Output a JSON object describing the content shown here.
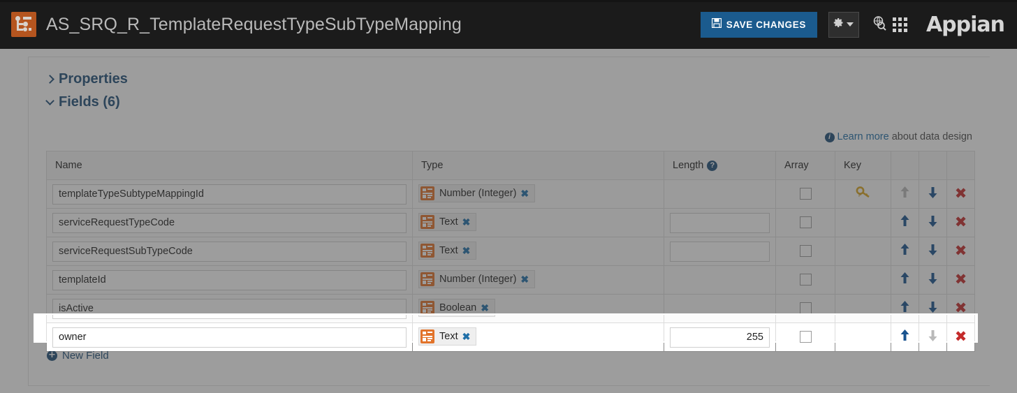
{
  "header": {
    "app_icon_name": "object-icon",
    "title": "AS_SRQ_R_TemplateRequestTypeSubTypeMapping",
    "save_label": "SAVE CHANGES",
    "settings_icon": "gear-icon",
    "caret_icon": "chevron-down-icon",
    "search_icon": "search-globe-icon",
    "apps_icon": "app-grid-icon",
    "brand": "Appian",
    "accent_blue": "#1b5b8e",
    "bar_background": "#1b1b1b"
  },
  "sections": {
    "properties_label": "Properties",
    "properties_expanded": false,
    "fields_label": "Fields (6)",
    "fields_expanded": true
  },
  "learn_more": {
    "info_icon": "info-icon",
    "link_text": "Learn more",
    "rest_text": " about data design"
  },
  "table": {
    "columns": [
      "Name",
      "Type",
      "Length",
      "Array",
      "Key",
      "",
      "",
      ""
    ],
    "length_help_icon": "question-mark-icon",
    "rows": [
      {
        "name": "templateTypeSubtypeMappingId",
        "type": "Number (Integer)",
        "length": "",
        "has_length_input": false,
        "array": false,
        "key": "primary-key-icon",
        "up_enabled": false,
        "down_enabled": true,
        "focused": false
      },
      {
        "name": "serviceRequestTypeCode",
        "type": "Text",
        "length": "",
        "has_length_input": true,
        "array": false,
        "key": "",
        "up_enabled": true,
        "down_enabled": true,
        "focused": false
      },
      {
        "name": "serviceRequestSubTypeCode",
        "type": "Text",
        "length": "",
        "has_length_input": true,
        "array": false,
        "key": "",
        "up_enabled": true,
        "down_enabled": true,
        "focused": false
      },
      {
        "name": "templateId",
        "type": "Number (Integer)",
        "length": "",
        "has_length_input": false,
        "array": false,
        "key": "",
        "up_enabled": true,
        "down_enabled": true,
        "focused": false
      },
      {
        "name": "isActive",
        "type": "Boolean",
        "length": "",
        "has_length_input": false,
        "array": false,
        "key": "",
        "up_enabled": true,
        "down_enabled": true,
        "focused": false
      },
      {
        "name": "owner",
        "type": "Text",
        "length": "255",
        "has_length_input": true,
        "array": false,
        "key": "",
        "up_enabled": true,
        "down_enabled": false,
        "focused": true
      }
    ],
    "remove_icon": "remove-x-icon",
    "move_up_icon": "arrow-up-icon",
    "move_down_icon": "arrow-down-icon",
    "type_icon": "data-type-icon",
    "chip_remove_icon": "clear-type-x-icon"
  },
  "new_field": {
    "plus_icon": "plus-circle-icon",
    "label": "New Field"
  }
}
